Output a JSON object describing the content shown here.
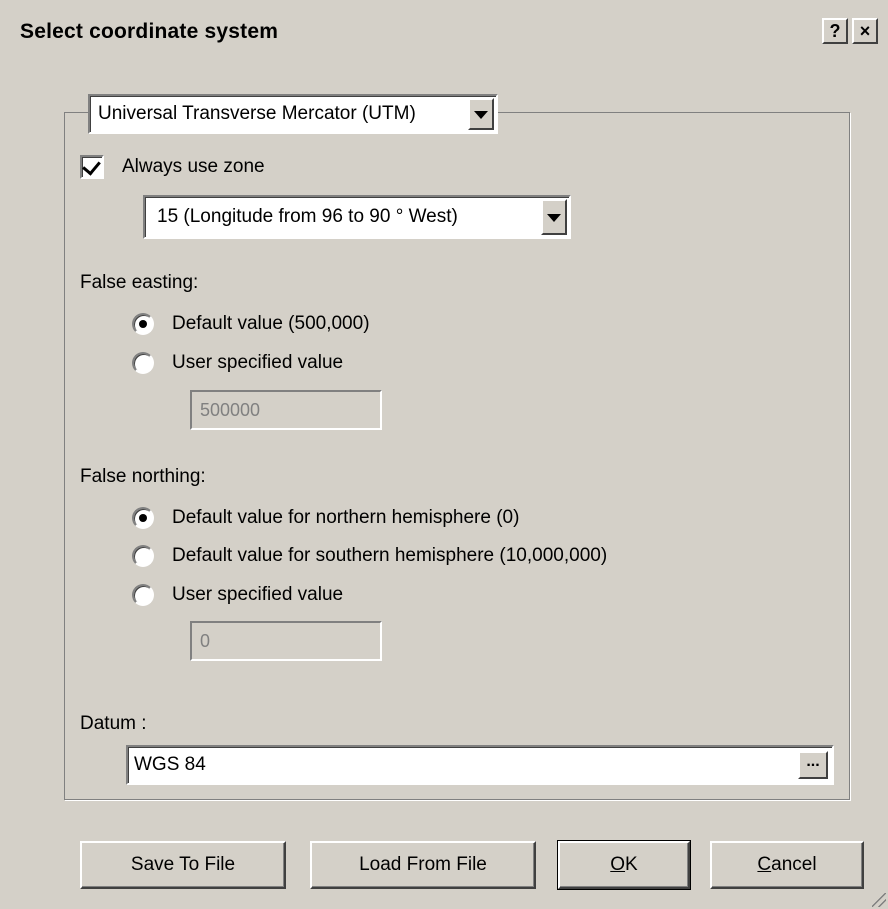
{
  "dialog": {
    "title": "Select coordinate system",
    "help_label": "?",
    "close_label": "×"
  },
  "projection": {
    "selected": "Universal Transverse Mercator (UTM)"
  },
  "zone": {
    "always_use_zone_label": "Always use zone",
    "always_use_zone_checked": true,
    "selected": "15   (Longitude from 96 to 90 ° West)"
  },
  "false_easting": {
    "label": "False easting:",
    "options": [
      "Default value  (500,000)",
      "User specified value"
    ],
    "selected_index": 0,
    "value": "500000"
  },
  "false_northing": {
    "label": "False northing:",
    "options": [
      "Default value for northern hemisphere  (0)",
      "Default value for southern hemisphere  (10,000,000)",
      "User specified value"
    ],
    "selected_index": 0,
    "value": "0"
  },
  "datum": {
    "label": "Datum :",
    "value": "WGS 84",
    "browse_label": "..."
  },
  "buttons": {
    "save": "Save To File",
    "load": "Load From File",
    "ok_mnemonic": "O",
    "ok_rest": "K",
    "cancel_mnemonic": "C",
    "cancel_rest": "ancel"
  }
}
